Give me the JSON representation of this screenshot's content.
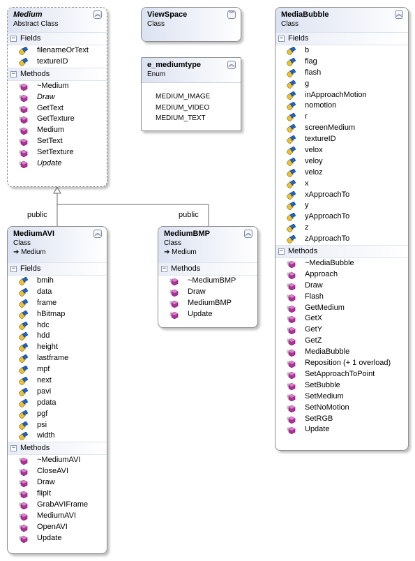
{
  "classes": {
    "medium": {
      "name": "Medium",
      "stereotype": "Abstract Class",
      "fields_label": "Fields",
      "methods_label": "Methods",
      "fields": [
        "filenameOrText",
        "textureID"
      ],
      "methods": [
        {
          "name": "~Medium",
          "italic": false
        },
        {
          "name": "Draw",
          "italic": true
        },
        {
          "name": "GetText",
          "italic": false
        },
        {
          "name": "GetTexture",
          "italic": false
        },
        {
          "name": "Medium",
          "italic": false
        },
        {
          "name": "SetText",
          "italic": false
        },
        {
          "name": "SetTexture",
          "italic": false
        },
        {
          "name": "Update",
          "italic": true
        }
      ]
    },
    "viewspace": {
      "name": "ViewSpace",
      "stereotype": "Class"
    },
    "mediumtype": {
      "name": "e_mediumtype",
      "stereotype": "Enum",
      "values": [
        "MEDIUM_IMAGE",
        "MEDIUM_VIDEO",
        "MEDIUM_TEXT"
      ]
    },
    "mediabubble": {
      "name": "MediaBubble",
      "stereotype": "Class",
      "fields_label": "Fields",
      "methods_label": "Methods",
      "fields": [
        "b",
        "flag",
        "flash",
        "g",
        "inApproachMotion",
        "nomotion",
        "r",
        "screenMedium",
        "textureID",
        "velox",
        "veloy",
        "veloz",
        "x",
        "xApproachTo",
        "y",
        "yApproachTo",
        "z",
        "zApproachTo"
      ],
      "methods": [
        "~MediaBubble",
        "Approach",
        "Draw",
        "Flash",
        "GetMedium",
        "GetX",
        "GetY",
        "GetZ",
        "MediaBubble",
        "Reposition (+ 1 overload)",
        "SetApproachToPoint",
        "SetBubble",
        "SetMedium",
        "SetNoMotion",
        "SetRGB",
        "Update"
      ]
    },
    "mediumavi": {
      "name": "MediumAVI",
      "stereotype": "Class",
      "base": "Medium",
      "fields_label": "Fields",
      "methods_label": "Methods",
      "fields": [
        "bmih",
        "data",
        "frame",
        "hBitmap",
        "hdc",
        "hdd",
        "height",
        "lastframe",
        "mpf",
        "next",
        "pavi",
        "pdata",
        "pgf",
        "psi",
        "width"
      ],
      "methods": [
        "~MediumAVI",
        "CloseAVI",
        "Draw",
        "flipIt",
        "GrabAVIFrame",
        "MediumAVI",
        "OpenAVI",
        "Update"
      ]
    },
    "mediumbmp": {
      "name": "MediumBMP",
      "stereotype": "Class",
      "base": "Medium",
      "methods_label": "Methods",
      "methods": [
        "~MediumBMP",
        "Draw",
        "MediumBMP",
        "Update"
      ]
    }
  },
  "relations": {
    "left_label": "public",
    "right_label": "public"
  },
  "icons": {
    "field": "field-icon",
    "method": "method-icon",
    "collapse": "chevron-up-icon",
    "expand": "chevron-down-icon",
    "inherit": "inheritance-arrow-icon"
  },
  "colors": {
    "header_gradient": "#dbe2f1",
    "field_icon": "#1e63c9",
    "method_icon": "#b0309a",
    "border": "#8e8e8e"
  }
}
